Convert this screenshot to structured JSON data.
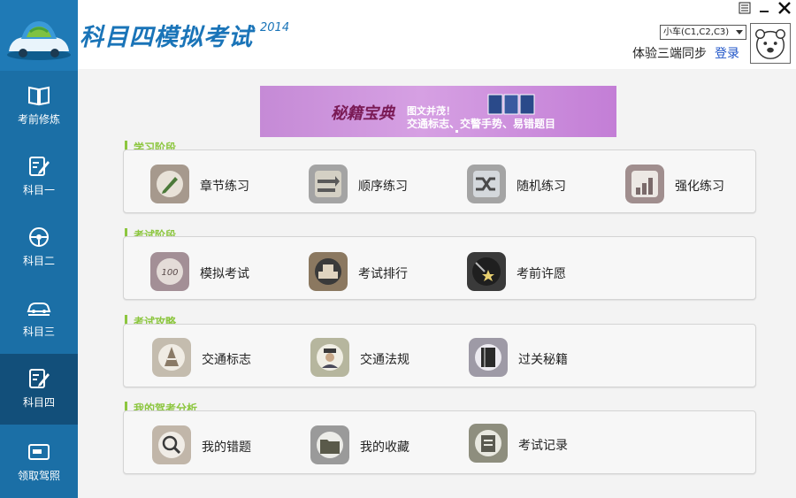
{
  "app": {
    "title": "科目四模拟考试",
    "year": "2014",
    "vehicle_select": "小车(C1,C2,C3)",
    "sync_text": "体验三端同步",
    "login": "登录"
  },
  "sidebar": {
    "items": [
      {
        "label": "考前修炼",
        "icon": "book-icon"
      },
      {
        "label": "科目一",
        "icon": "edit-icon"
      },
      {
        "label": "科目二",
        "icon": "steering-wheel-icon"
      },
      {
        "label": "科目三",
        "icon": "car-icon"
      },
      {
        "label": "科目四",
        "icon": "edit-icon",
        "active": true
      },
      {
        "label": "领取驾照",
        "icon": "license-card-icon"
      }
    ]
  },
  "banner": {
    "brand": "秘籍宝典",
    "line1": "图文并茂！",
    "line2": "交通标志、交警手势、易错题目"
  },
  "sections": [
    {
      "title": "学习阶段",
      "items": [
        {
          "label": "章节练习",
          "icon": "pencil-icon",
          "color": "#a6998d"
        },
        {
          "label": "顺序练习",
          "icon": "arrows-icon",
          "color": "#a4a4a4"
        },
        {
          "label": "随机练习",
          "icon": "shuffle-icon",
          "color": "#a4a4a4"
        },
        {
          "label": "强化练习",
          "icon": "chart-icon",
          "color": "#a08e8e"
        }
      ]
    },
    {
      "title": "考试阶段",
      "items": [
        {
          "label": "模拟考试",
          "icon": "score-100-icon",
          "color": "#a38f96"
        },
        {
          "label": "考试排行",
          "icon": "podium-icon",
          "color": "#8b7860"
        },
        {
          "label": "考前许愿",
          "icon": "shooting-star-icon",
          "color": "#3a3a3a"
        }
      ]
    },
    {
      "title": "考试攻略",
      "items": [
        {
          "label": "交通标志",
          "icon": "road-cone-icon",
          "color": "#c4bcae"
        },
        {
          "label": "交通法规",
          "icon": "police-officer-icon",
          "color": "#b6b69e"
        },
        {
          "label": "过关秘籍",
          "icon": "secret-book-icon",
          "color": "#9e9aa6"
        }
      ]
    },
    {
      "title": "我的驾考分析",
      "items": [
        {
          "label": "我的错题",
          "icon": "magnifier-icon",
          "color": "#c1b6a9"
        },
        {
          "label": "我的收藏",
          "icon": "folder-icon",
          "color": "#9a9a9a"
        },
        {
          "label": "考试记录",
          "icon": "record-icon",
          "color": "#8e8e7e"
        }
      ]
    }
  ]
}
